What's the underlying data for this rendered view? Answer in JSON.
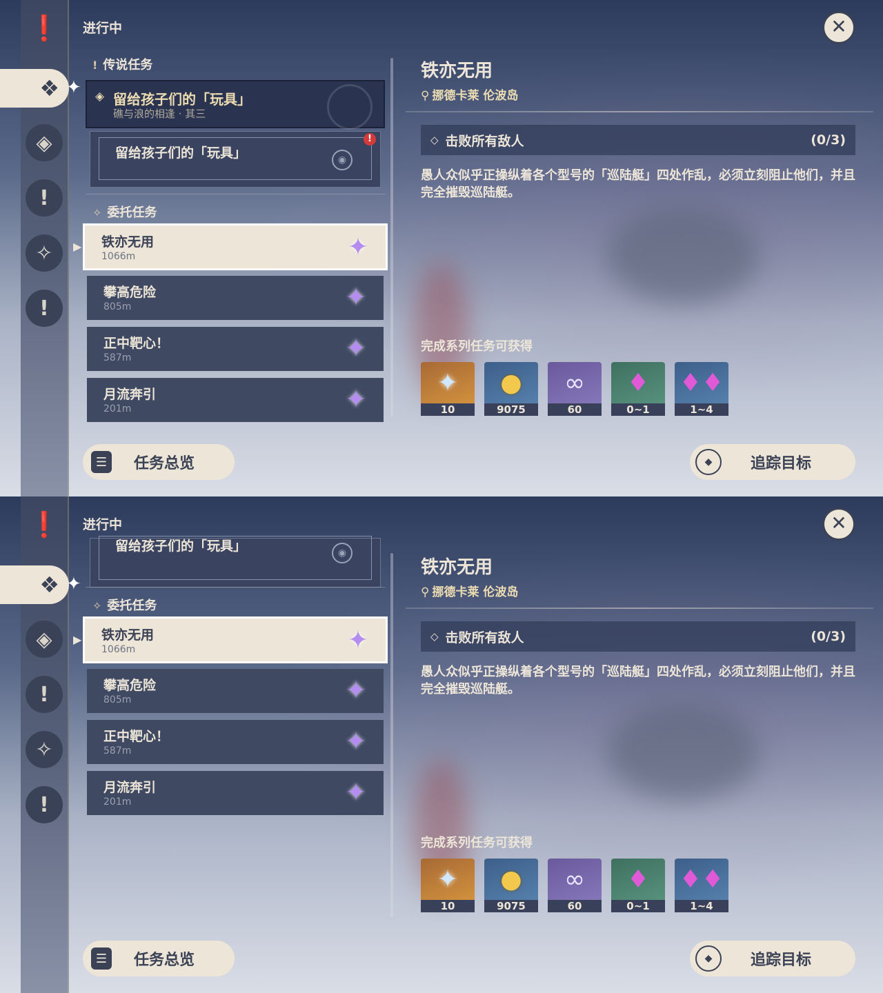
{
  "header": {
    "in_progress": "进行中"
  },
  "sections": {
    "archon": "传说任务",
    "commission": "委托任务"
  },
  "story_quest": {
    "title": "留给孩子们的「玩具」",
    "subtitle": "礁与浪的相逢 · 其三"
  },
  "story_subquest": {
    "title": "留给孩子们的「玩具」"
  },
  "quests": [
    {
      "name": "铁亦无用",
      "distance": "1066m",
      "selected": true
    },
    {
      "name": "攀高危险",
      "distance": "805m"
    },
    {
      "name": "正中靶心！",
      "distance": "587m"
    },
    {
      "name": "月流奔引",
      "distance": "201m"
    }
  ],
  "detail": {
    "title": "铁亦无用",
    "location": "挪德卡莱 伦波岛",
    "objective": "击败所有敌人",
    "objective_progress": "(0/3)",
    "description": "愚人众似乎正操纵着各个型号的「巡陆艇」四处作乱，必须立刻阻止他们，并且完全摧毁巡陆艇。",
    "rewards_title": "完成系列任务可获得",
    "rewards": [
      {
        "icon": "primogem-icon",
        "qty": "10"
      },
      {
        "icon": "mora-icon",
        "qty": "9075"
      },
      {
        "icon": "companionship-exp-icon",
        "qty": "60"
      },
      {
        "icon": "crystal-chunk-icon",
        "qty": "0~1"
      },
      {
        "icon": "crystal-cluster-icon",
        "qty": "1~4"
      }
    ]
  },
  "buttons": {
    "overview": "任务总览",
    "track": "追踪目标"
  },
  "colors": {
    "panel_cream": "#ece5d8",
    "panel_dark": "#3f4962",
    "gem_purple": "#b58cf0"
  }
}
